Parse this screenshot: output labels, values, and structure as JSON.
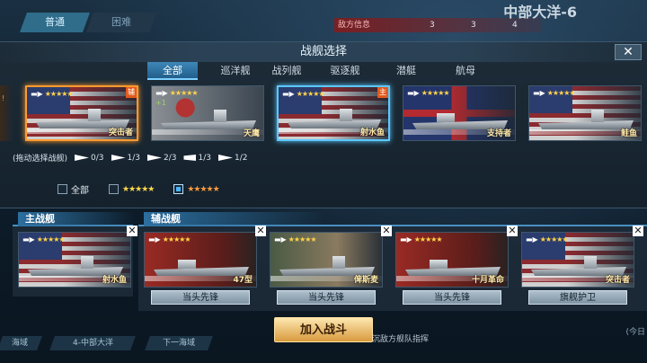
{
  "top_tabs": [
    "普通",
    "困难"
  ],
  "map_title": "中部大洋-6",
  "enemy_info": {
    "label": "敌方信息",
    "counts": [
      "3",
      "3",
      "4"
    ]
  },
  "dialog": {
    "title": "战舰选择",
    "close": "✕",
    "categories": [
      "全部",
      "巡洋舰",
      "战列舰",
      "驱逐舰",
      "潜艇",
      "航母"
    ],
    "ships": [
      {
        "name": "突击者",
        "flag": "us",
        "badge": "辅"
      },
      {
        "name": "天鹰",
        "flag": "jp",
        "level": "+1"
      },
      {
        "name": "射水鱼",
        "flag": "us",
        "badge": "主"
      },
      {
        "name": "支持者",
        "flag": "gb"
      },
      {
        "name": "鲑鱼",
        "flag": "us"
      }
    ],
    "drag_hint": "(拖动选择战舰)",
    "counts": [
      "0/3",
      "1/3",
      "2/3",
      "1/3",
      "1/2"
    ],
    "filters": {
      "all": "全部",
      "white_stars": "★★★★★",
      "orange_stars": "★★★★★"
    }
  },
  "fleet": {
    "main_label": "主战舰",
    "support_label": "辅战舰",
    "main_ship": {
      "name": "射水鱼"
    },
    "support_ships": [
      {
        "name": "47型",
        "role": "当头先锋"
      },
      {
        "name": "俾斯麦",
        "role": "当头先锋"
      },
      {
        "name": "十月革命",
        "role": "当头先锋"
      },
      {
        "name": "突击者",
        "role": "旗舰护卫"
      }
    ]
  },
  "join_button": "加入战斗",
  "bottom_text": "沉敌方舰队指挥",
  "bottom_nav": [
    "海域",
    "4-中部大洋",
    "下一海域"
  ],
  "today_label": "(今日",
  "stars": "★★★★★"
}
